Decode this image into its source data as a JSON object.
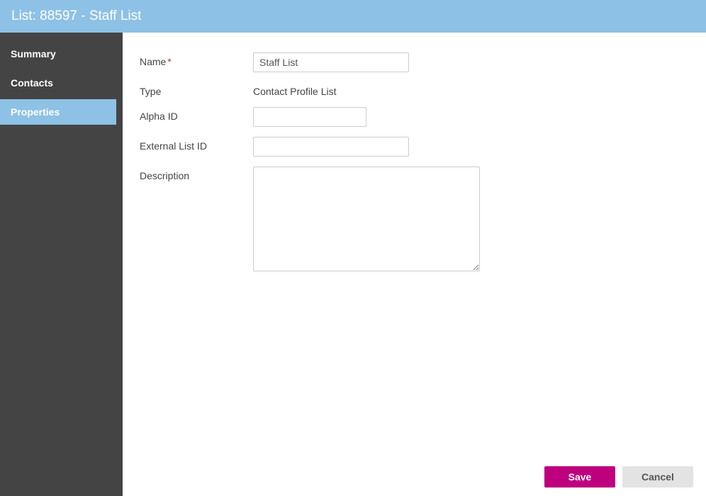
{
  "header": {
    "title": "List: 88597 - Staff List"
  },
  "sidebar": {
    "items": [
      {
        "label": "Summary",
        "active": false
      },
      {
        "label": "Contacts",
        "active": false
      },
      {
        "label": "Properties",
        "active": true
      }
    ]
  },
  "form": {
    "name_label": "Name",
    "name_value": "Staff List",
    "type_label": "Type",
    "type_value": "Contact Profile List",
    "alpha_id_label": "Alpha ID",
    "alpha_id_value": "",
    "external_list_id_label": "External List ID",
    "external_list_id_value": "",
    "description_label": "Description",
    "description_value": ""
  },
  "footer": {
    "save_label": "Save",
    "cancel_label": "Cancel"
  }
}
